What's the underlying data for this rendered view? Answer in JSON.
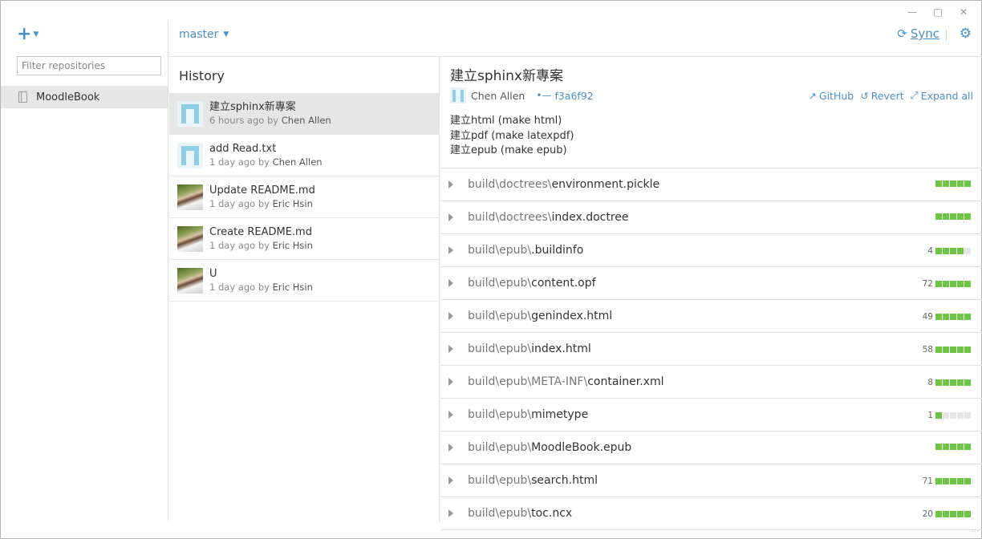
{
  "window": {
    "minimize_glyph": "🗕",
    "maximize_glyph": "🗖",
    "close_glyph": "✕"
  },
  "sidebar": {
    "filter_placeholder": "Filter repositories",
    "repositories": [
      {
        "name": "MoodleBook",
        "selected": true
      }
    ]
  },
  "topbar": {
    "branch": "master",
    "sync_label": "Sync"
  },
  "history": {
    "title": "History",
    "commits": [
      {
        "title": "建立sphinx新專案",
        "time": "6 hours ago by",
        "author": "Chen Allen",
        "avatar": "identicon",
        "selected": true
      },
      {
        "title": "add Read.txt",
        "time": "1 day ago by",
        "author": "Chen Allen",
        "avatar": "identicon",
        "selected": false
      },
      {
        "title": "Update README.md",
        "time": "1 day ago by",
        "author": "Eric Hsin",
        "avatar": "photo",
        "selected": false
      },
      {
        "title": "Create README.md",
        "time": "1 day ago by",
        "author": "Eric Hsin",
        "avatar": "photo",
        "selected": false
      },
      {
        "title": "U",
        "time": "1 day ago by",
        "author": "Eric Hsin",
        "avatar": "photo",
        "selected": false
      }
    ]
  },
  "detail": {
    "title": "建立sphinx新專案",
    "author": "Chen Allen",
    "sha": "f3a6f92",
    "actions": {
      "github": "GitHub",
      "revert": "Revert",
      "expand_all": "Expand all"
    },
    "description": [
      "建立html (make html)",
      "建立pdf (make latexpdf)",
      "建立epub (make epub)"
    ],
    "files": [
      {
        "dir": "build\\doctrees\\",
        "name": "environment.pickle",
        "count": "",
        "added_boxes": 5
      },
      {
        "dir": "build\\doctrees\\",
        "name": "index.doctree",
        "count": "",
        "added_boxes": 5
      },
      {
        "dir": "build\\epub\\",
        "name": ".buildinfo",
        "count": "4",
        "added_boxes": 4
      },
      {
        "dir": "build\\epub\\",
        "name": "content.opf",
        "count": "72",
        "added_boxes": 5
      },
      {
        "dir": "build\\epub\\",
        "name": "genindex.html",
        "count": "49",
        "added_boxes": 5
      },
      {
        "dir": "build\\epub\\",
        "name": "index.html",
        "count": "58",
        "added_boxes": 5
      },
      {
        "dir": "build\\epub\\META-INF\\",
        "name": "container.xml",
        "count": "8",
        "added_boxes": 5
      },
      {
        "dir": "build\\epub\\",
        "name": "mimetype",
        "count": "1",
        "added_boxes": 1
      },
      {
        "dir": "build\\epub\\",
        "name": "MoodleBook.epub",
        "count": "",
        "added_boxes": 5
      },
      {
        "dir": "build\\epub\\",
        "name": "search.html",
        "count": "71",
        "added_boxes": 5
      },
      {
        "dir": "build\\epub\\",
        "name": "toc.ncx",
        "count": "20",
        "added_boxes": 5
      }
    ]
  },
  "colors": {
    "accent": "#4a90c8",
    "diff_add": "#6cc644",
    "selected_bg": "#e6e6e6"
  }
}
